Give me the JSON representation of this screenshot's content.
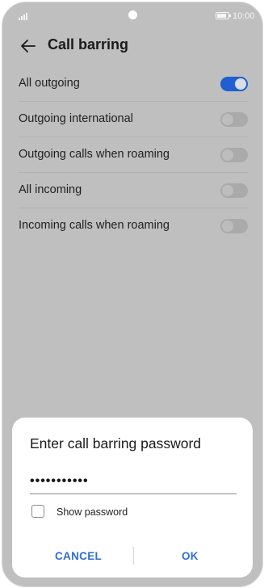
{
  "status_bar": {
    "time": "10:00",
    "battery_level": 0.85,
    "signal_icon": "signal-icon",
    "battery_icon": "battery-icon"
  },
  "app_bar": {
    "title": "Call barring",
    "back_icon": "back-arrow-icon"
  },
  "settings": [
    {
      "label": "All outgoing",
      "enabled": true
    },
    {
      "label": "Outgoing international",
      "enabled": false
    },
    {
      "label": "Outgoing calls when roaming",
      "enabled": false
    },
    {
      "label": "All incoming",
      "enabled": false
    },
    {
      "label": "Incoming calls when roaming",
      "enabled": false
    }
  ],
  "dialog": {
    "title": "Enter call barring password",
    "password_value": "•••••••••••",
    "show_password_label": "Show password",
    "show_password_checked": false,
    "cancel_label": "CANCEL",
    "ok_label": "OK"
  },
  "colors": {
    "accent": "#1f5fd1",
    "button_text": "#2f6fd0",
    "scrim": "#bfbfbf"
  }
}
